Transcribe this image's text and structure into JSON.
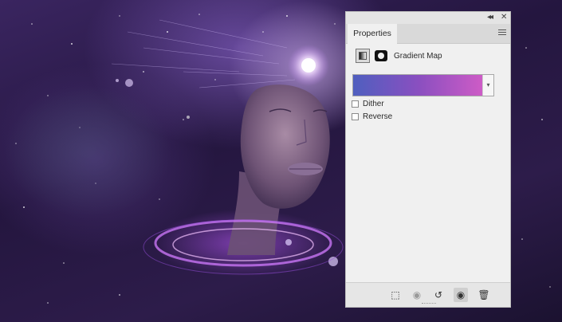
{
  "panel": {
    "collapse_glyph": "◂◂",
    "close_glyph": "✕",
    "tab_label": "Properties",
    "menu_icon": "panel-menu-icon",
    "adjustment_title": "Gradient Map",
    "gradient": {
      "start_color": "#4f5fbf",
      "mid_color": "#8a4fc0",
      "end_color": "#cf5cc6"
    },
    "options": [
      {
        "label": "Dither",
        "checked": false
      },
      {
        "label": "Reverse",
        "checked": false
      }
    ],
    "bottom_icons": [
      {
        "name": "clip-to-layer-icon",
        "glyph": "⬚"
      },
      {
        "name": "view-previous-state-icon",
        "glyph": "◉"
      },
      {
        "name": "reset-icon",
        "glyph": "↺"
      },
      {
        "name": "visibility-eye-icon",
        "glyph": "◉"
      },
      {
        "name": "trash-icon",
        "glyph": "🗑"
      }
    ]
  }
}
